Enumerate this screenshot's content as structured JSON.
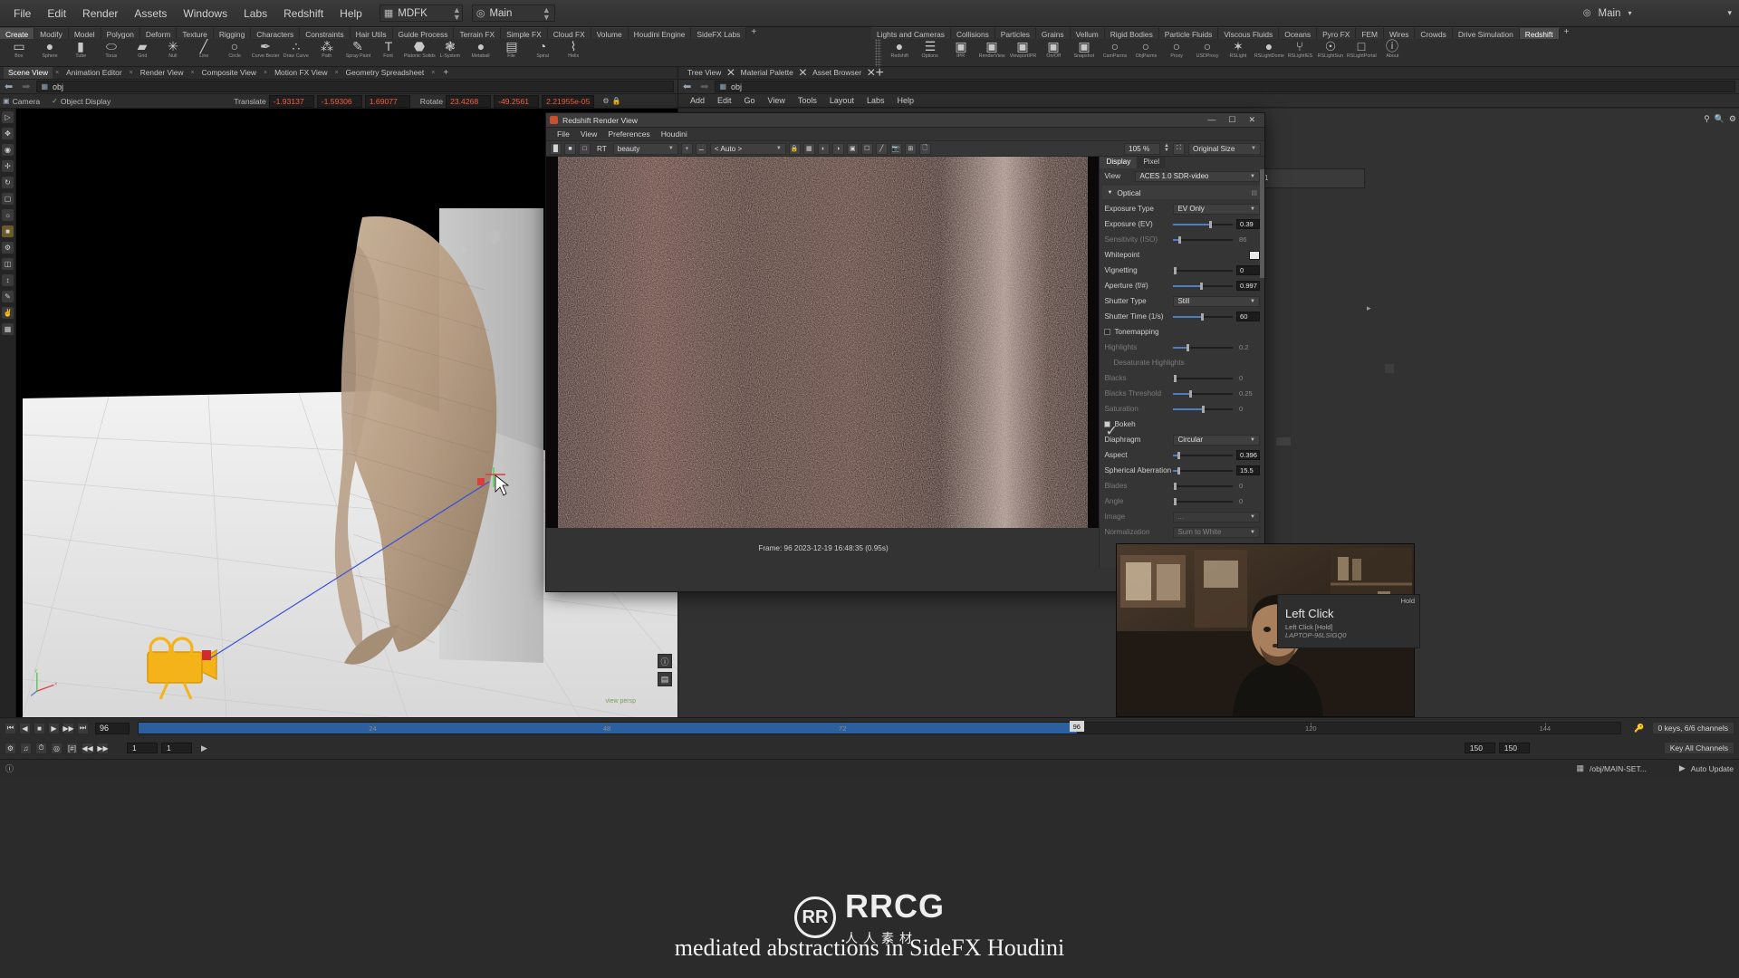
{
  "app": {
    "title": "SideFX Houdini",
    "menu": [
      "File",
      "Edit",
      "Render",
      "Assets",
      "Windows",
      "Labs",
      "Redshift",
      "Help"
    ],
    "desktop_selector": "MDFK",
    "layout_selector": "Main",
    "top_right_label": "Main"
  },
  "shelf": {
    "left_tabs": [
      "Create",
      "Modify",
      "Model",
      "Polygon",
      "Deform",
      "Texture",
      "Rigging",
      "Characters",
      "Constraints",
      "Hair Utils",
      "Guide Process",
      "Terrain FX",
      "Simple FX",
      "Cloud FX",
      "Volume",
      "Houdini Engine",
      "SideFX Labs"
    ],
    "left_active_tab": "Create",
    "left_tools": [
      {
        "label": "Box",
        "icon": "box-icon",
        "glyph": "▭"
      },
      {
        "label": "Sphere",
        "icon": "sphere-icon",
        "glyph": "●"
      },
      {
        "label": "Tube",
        "icon": "tube-icon",
        "glyph": "▮"
      },
      {
        "label": "Torus",
        "icon": "torus-icon",
        "glyph": "⬭"
      },
      {
        "label": "Grid",
        "icon": "grid-icon",
        "glyph": "▰"
      },
      {
        "label": "Null",
        "icon": "null-icon",
        "glyph": "✳"
      },
      {
        "label": "Line",
        "icon": "line-icon",
        "glyph": "╱"
      },
      {
        "label": "Circle",
        "icon": "circle-icon",
        "glyph": "○"
      },
      {
        "label": "Curve Bezier",
        "icon": "curve-bezier-icon",
        "glyph": "✒"
      },
      {
        "label": "Draw Curve",
        "icon": "draw-curve-icon",
        "glyph": "∴"
      },
      {
        "label": "Path",
        "icon": "path-icon",
        "glyph": "⁂"
      },
      {
        "label": "Spray Paint",
        "icon": "spray-paint-icon",
        "glyph": "✎"
      },
      {
        "label": "Font",
        "icon": "font-icon",
        "glyph": "T"
      },
      {
        "label": "Platonic Solids",
        "icon": "platonic-solids-icon",
        "glyph": "⬣"
      },
      {
        "label": "L-System",
        "icon": "lsystem-icon",
        "glyph": "❃"
      },
      {
        "label": "Metaball",
        "icon": "metaball-icon",
        "glyph": "●"
      },
      {
        "label": "File",
        "icon": "file-icon",
        "glyph": "▤"
      },
      {
        "label": "Spiral",
        "icon": "spiral-icon",
        "glyph": "◔"
      },
      {
        "label": "Helix",
        "icon": "helix-icon",
        "glyph": "⌇"
      }
    ],
    "right_tabs": [
      "Lights and Cameras",
      "Collisions",
      "Particles",
      "Grains",
      "Vellum",
      "Rigid Bodies",
      "Particle Fluids",
      "Viscous Fluids",
      "Oceans",
      "Pyro FX",
      "FEM",
      "Wires",
      "Crowds",
      "Drive Simulation",
      "Redshift"
    ],
    "right_active_tab": "Redshift",
    "right_tools": [
      {
        "label": "Redshift",
        "icon": "redshift-logo-icon",
        "glyph": "●"
      },
      {
        "label": "Options",
        "icon": "options-icon",
        "glyph": "☰"
      },
      {
        "label": "IPR",
        "icon": "ipr-icon",
        "glyph": "▣"
      },
      {
        "label": "RenderView",
        "icon": "render-view-icon",
        "glyph": "▣"
      },
      {
        "label": "ViewportIPR",
        "icon": "viewport-ipr-icon",
        "glyph": "▣"
      },
      {
        "label": "On/Off",
        "icon": "on-off-icon",
        "glyph": "▣"
      },
      {
        "label": "Snapshot",
        "icon": "snapshot-icon",
        "glyph": "▣"
      },
      {
        "label": "CamParms",
        "icon": "cam-parms-icon",
        "glyph": "○"
      },
      {
        "label": "ObjParms",
        "icon": "obj-parms-icon",
        "glyph": "○"
      },
      {
        "label": "Proxy",
        "icon": "proxy-icon",
        "glyph": "○"
      },
      {
        "label": "USDProxy",
        "icon": "usd-proxy-icon",
        "glyph": "○"
      },
      {
        "label": "RSLight",
        "icon": "rs-light-icon",
        "glyph": "✶"
      },
      {
        "label": "RSLightDome",
        "icon": "rs-light-dome-icon",
        "glyph": "●"
      },
      {
        "label": "RSLightIES",
        "icon": "rs-light-ies-icon",
        "glyph": "⑂"
      },
      {
        "label": "RSLightSun",
        "icon": "rs-light-sun-icon",
        "glyph": "☉"
      },
      {
        "label": "RSLightPortal",
        "icon": "rs-light-portal-icon",
        "glyph": "□"
      },
      {
        "label": "About",
        "icon": "about-icon",
        "glyph": "ⓘ"
      }
    ]
  },
  "left_pane": {
    "tabs": [
      "Scene View",
      "Animation Editor",
      "Render View",
      "Composite View",
      "Motion FX View",
      "Geometry Spreadsheet"
    ],
    "active_tab": "Scene View",
    "path_value": "obj",
    "viewport_header": {
      "camera_label": "Camera",
      "display_label": "Object Display",
      "translate_label": "Translate",
      "translate": [
        "-1.93137",
        "-1.59306",
        "1.69077"
      ],
      "rotate_label": "Rotate",
      "rotate": [
        "23.4268",
        "-49.2561",
        "2.21955e-05"
      ]
    },
    "viewport_hud": {
      "axis_labels": [
        "x",
        "y",
        "z"
      ],
      "corner_text": "view  persp"
    }
  },
  "right_pane": {
    "tabs": [
      "Tree View",
      "Material Palette",
      "Asset Browser"
    ],
    "path_value": "obj",
    "menu": [
      "Add",
      "Edit",
      "Go",
      "View",
      "Tools",
      "Layout",
      "Labs",
      "Help"
    ],
    "node_value": "1"
  },
  "render_view": {
    "window_title": "Redshift Render View",
    "window_buttons": [
      "—",
      "☐",
      "✕"
    ],
    "menu": [
      "File",
      "View",
      "Preferences",
      "Houdini"
    ],
    "toolbar": {
      "render_mode": "RT",
      "aov_select": "beauty",
      "auto_select": "< Auto >",
      "zoom_value": "105 %",
      "size_select": "Original Size"
    },
    "status": "Frame: 96  2023-12-19  16:48:35  (0.95s)",
    "params": {
      "tabs": [
        "Display",
        "Pixel"
      ],
      "active_tab": "Display",
      "view_label": "View",
      "view_value": "ACES 1.0 SDR-video",
      "section_optical": "Optical",
      "rows": [
        {
          "label": "Exposure Type",
          "type": "select",
          "value": "EV Only",
          "dim": false
        },
        {
          "label": "Exposure (EV)",
          "type": "slider",
          "value": "0.39",
          "fill": 60,
          "handle": 60,
          "dim": false
        },
        {
          "label": "Sensitivity (ISO)",
          "type": "slider",
          "value": "86",
          "fill": 8,
          "handle": 8,
          "dim": true
        },
        {
          "label": "Whitepoint",
          "type": "swatch",
          "value": "",
          "color": "#e8e8e8",
          "dim": false
        },
        {
          "label": "Vignetting",
          "type": "slider",
          "value": "0",
          "fill": 0,
          "handle": 1,
          "dim": false
        },
        {
          "label": "Aperture (f/#)",
          "type": "slider",
          "value": "0.997",
          "fill": 45,
          "handle": 45,
          "dim": false
        },
        {
          "label": "Shutter Type",
          "type": "select",
          "value": "Still",
          "dim": false
        },
        {
          "label": "Shutter Time (1/s)",
          "type": "slider",
          "value": "60",
          "fill": 46,
          "handle": 46,
          "dim": false
        }
      ],
      "tonemapping_label": "Tonemapping",
      "tonemapping_checked": false,
      "rows2": [
        {
          "label": "Highlights",
          "type": "slider",
          "value": "0.2",
          "fill": 22,
          "handle": 22,
          "dim": true
        },
        {
          "label": "Desaturate Highlights",
          "type": "sublabel",
          "value": "",
          "dim": true
        },
        {
          "label": "Blacks",
          "type": "slider",
          "value": "0",
          "fill": 0,
          "handle": 1,
          "dim": true
        },
        {
          "label": "Blacks Threshold",
          "type": "slider",
          "value": "0.25",
          "fill": 27,
          "handle": 27,
          "dim": true
        },
        {
          "label": "Saturation",
          "type": "slider",
          "value": "0",
          "fill": 48,
          "handle": 48,
          "dim": true
        }
      ],
      "bokeh_label": "Bokeh",
      "bokeh_checked": true,
      "rows3": [
        {
          "label": "Diaphragm",
          "type": "select",
          "value": "Circular",
          "dim": false
        },
        {
          "label": "Aspect",
          "type": "slider",
          "value": "0.396",
          "fill": 7,
          "handle": 7,
          "dim": false
        },
        {
          "label": "Spherical Aberration",
          "type": "slider",
          "value": "15.5",
          "fill": 7,
          "handle": 7,
          "dim": false
        },
        {
          "label": "Blades",
          "type": "slider",
          "value": "0",
          "fill": 0,
          "handle": 1,
          "dim": true
        },
        {
          "label": "Angle",
          "type": "slider",
          "value": "0",
          "fill": 0,
          "handle": 1,
          "dim": true
        },
        {
          "label": "Image",
          "type": "file",
          "value": "...",
          "dim": true
        },
        {
          "label": "Normalization",
          "type": "select",
          "value": "Sum to White",
          "dim": true
        }
      ]
    }
  },
  "timeline": {
    "current_frame": "96",
    "playhead_label": "96",
    "ticks": [
      {
        "label": "24",
        "pct": 15.8
      },
      {
        "label": "48",
        "pct": 31.6
      },
      {
        "label": "72",
        "pct": 47.5
      },
      {
        "label": "96",
        "pct": 63.3
      },
      {
        "label": "120",
        "pct": 79.1
      },
      {
        "label": "144",
        "pct": 94.9
      }
    ],
    "range_start": "1",
    "range_start2": "1",
    "range_end": "150",
    "range_end2": "150",
    "channels_text": "0 keys, 6/6 channels",
    "key_all_channels": "Key All Channels",
    "auto_update": "Auto Update",
    "status_path": "/obj/MAIN-SET..."
  },
  "hold_overlay": {
    "corner_label": "Hold",
    "title": "Left Click",
    "line1": "Left Click [Hold]",
    "line2": "LAPTOP-96LSIGQ0"
  },
  "watermark": {
    "logo_text": "RR",
    "brand": "RRCG",
    "chinese": "人人素材",
    "caption": "mediated abstractions in SideFX Houdini"
  },
  "colors": {
    "accent_blue": "#2c5f9e",
    "slider_blue": "#4a7fc1",
    "value_orange": "#ff5a3c",
    "panel_bg": "#2b2b2b",
    "redshift_red": "#c8502e"
  }
}
